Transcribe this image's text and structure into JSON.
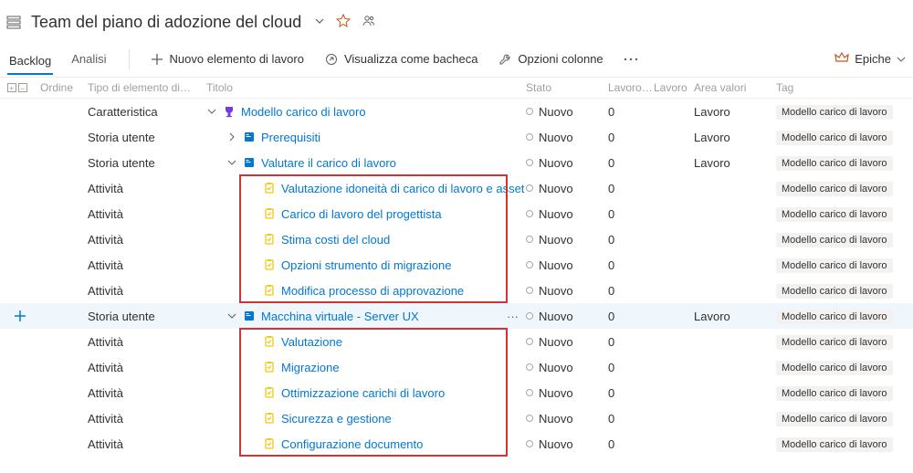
{
  "header": {
    "title": "Team del piano di adozione del cloud"
  },
  "toolbar": {
    "tab_backlog": "Backlog",
    "tab_analysis": "Analisi",
    "new_item": "Nuovo elemento di lavoro",
    "view_board": "Visualizza come bacheca",
    "column_options": "Opzioni colonne",
    "epics_label": "Epiche"
  },
  "columns": {
    "order": "Ordine",
    "type": "Tipo di elemento di…",
    "title": "Titolo",
    "state": "Stato",
    "effort": "Lavoro…",
    "work": "Lavoro",
    "area": "Area valori",
    "tags": "Tag"
  },
  "types": {
    "feature": "Caratteristica",
    "story": "Storia utente",
    "task": "Attività"
  },
  "state_new": "Nuovo",
  "area_value": "Lavoro",
  "tag_value": "Modello carico di lavoro",
  "rows": [
    {
      "type": "feature",
      "indent": 1,
      "expander": "down",
      "icon": "trophy",
      "title": "Modello carico di lavoro",
      "effort": "0",
      "area": true
    },
    {
      "type": "story",
      "indent": 2,
      "expander": "right",
      "icon": "book",
      "title": "Prerequisiti",
      "effort": "0",
      "area": true
    },
    {
      "type": "story",
      "indent": 2,
      "expander": "down",
      "icon": "book",
      "title": "Valutare il carico di lavoro",
      "effort": "0",
      "area": true
    },
    {
      "type": "task",
      "indent": 3,
      "expander": "",
      "icon": "clip",
      "title": "Valutazione idoneità di carico di lavoro e asset",
      "effort": "0"
    },
    {
      "type": "task",
      "indent": 3,
      "expander": "",
      "icon": "clip",
      "title": "Carico di lavoro del progettista",
      "effort": "0"
    },
    {
      "type": "task",
      "indent": 3,
      "expander": "",
      "icon": "clip",
      "title": "Stima costi del cloud",
      "effort": "0"
    },
    {
      "type": "task",
      "indent": 3,
      "expander": "",
      "icon": "clip",
      "title": "Opzioni strumento di migrazione",
      "effort": "0"
    },
    {
      "type": "task",
      "indent": 3,
      "expander": "",
      "icon": "clip",
      "title": "Modifica processo di approvazione",
      "effort": "0"
    },
    {
      "type": "story",
      "indent": 2,
      "expander": "down",
      "icon": "book",
      "title": "Macchina virtuale - Server UX",
      "effort": "0",
      "area": true,
      "selected": true
    },
    {
      "type": "task",
      "indent": 3,
      "expander": "",
      "icon": "clip",
      "title": "Valutazione",
      "effort": "0"
    },
    {
      "type": "task",
      "indent": 3,
      "expander": "",
      "icon": "clip",
      "title": "Migrazione",
      "effort": "0"
    },
    {
      "type": "task",
      "indent": 3,
      "expander": "",
      "icon": "clip",
      "title": "Ottimizzazione carichi di lavoro",
      "effort": "0"
    },
    {
      "type": "task",
      "indent": 3,
      "expander": "",
      "icon": "clip",
      "title": "Sicurezza e gestione",
      "effort": "0"
    },
    {
      "type": "task",
      "indent": 3,
      "expander": "",
      "icon": "clip",
      "title": "Configurazione documento",
      "effort": "0"
    }
  ],
  "redbox1": {
    "start": 3,
    "end": 7
  },
  "redbox2": {
    "start": 9,
    "end": 13
  }
}
